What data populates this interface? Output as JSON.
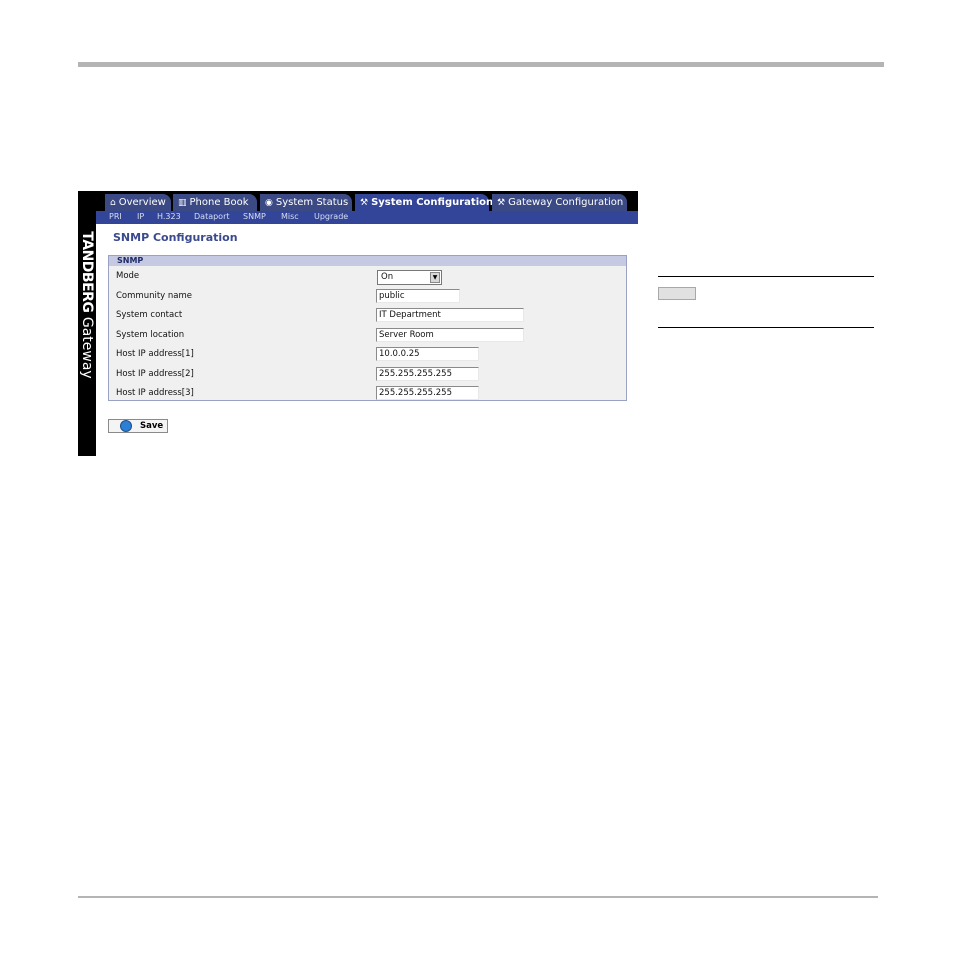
{
  "brand": {
    "logo_text": "TANDBERG",
    "product": "Gateway"
  },
  "tabs": [
    {
      "icon": "house-icon",
      "label": "Overview",
      "active": false
    },
    {
      "icon": "phone-book-icon",
      "label": "Phone Book",
      "active": false
    },
    {
      "icon": "power-icon",
      "label": "System Status",
      "active": false
    },
    {
      "icon": "tools-icon",
      "label": "System Configuration",
      "active": true
    },
    {
      "icon": "tools-icon",
      "label": "Gateway Configuration",
      "active": false
    }
  ],
  "subnav": [
    "PRI",
    "IP",
    "H.323",
    "Dataport",
    "SNMP",
    "Misc",
    "Upgrade"
  ],
  "page_title": "SNMP Configuration",
  "panel": {
    "heading": "SNMP",
    "fields": [
      {
        "label": "Mode",
        "type": "select",
        "value": "On"
      },
      {
        "label": "Community name",
        "type": "text",
        "value": "public"
      },
      {
        "label": "System contact",
        "type": "text",
        "value": "IT Department"
      },
      {
        "label": "System location",
        "type": "text",
        "value": "Server Room"
      },
      {
        "label": "Host IP address[1]",
        "type": "text",
        "value": "10.0.0.25"
      },
      {
        "label": "Host IP address[2]",
        "type": "text",
        "value": "255.255.255.255"
      },
      {
        "label": "Host IP address[3]",
        "type": "text",
        "value": "255.255.255.255"
      }
    ]
  },
  "save_label": "Save",
  "colors": {
    "tab_bg": "#3b4a85",
    "active_tab_bg": "#324599",
    "title": "#3a4a8c",
    "rule": "#b4b4b4"
  }
}
